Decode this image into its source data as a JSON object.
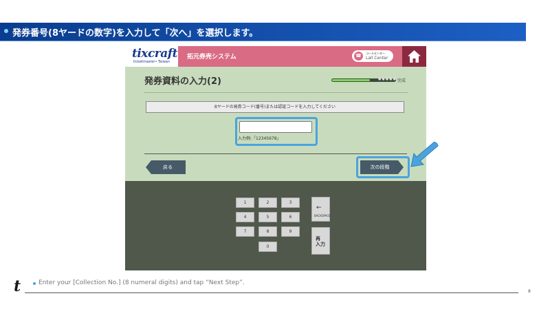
{
  "banner": {
    "title": "発券番号(8ヤードの数字)を入力して「次へ」を選択します。"
  },
  "kiosk": {
    "logo": {
      "main": "tixcraft",
      "sub": "ticketmaster• Taiwan"
    },
    "title": "拓元券売システム",
    "call_center": {
      "jp": "コールセンター",
      "en": "Lall Center"
    },
    "heading": "発券資料の入力(2)",
    "progress": {
      "label": "完成",
      "fraction": 0.6
    },
    "instruction": "8ヤードの発券コード(番号)または認証コードを入力してください",
    "input_value": "",
    "example": "入力例:「12345678」",
    "back_label": "戻る",
    "next_label": "次の段階",
    "keys": [
      "1",
      "2",
      "3",
      "4",
      "5",
      "6",
      "7",
      "8",
      "9",
      "0"
    ],
    "backspace_label": "BACKSPACE",
    "reinput_label": "再入力"
  },
  "footer": {
    "logo": "t",
    "caption": "Enter your [Collection No.] (8 numeral digits) and tap “Next Step”.",
    "page_number": "8"
  },
  "colors": {
    "banner_bg": "#0a3d8f",
    "kiosk_bg": "#c8dcbd",
    "title_bar": "#d96b84",
    "home_button": "#8b2a3e",
    "highlight": "#4aa3df",
    "keypad_bg": "#4f584a"
  },
  "icons": {
    "home": "home-icon",
    "phone": "phone-icon",
    "backspace": "backspace-arrow-icon",
    "pointer": "pointer-arrow-icon"
  }
}
